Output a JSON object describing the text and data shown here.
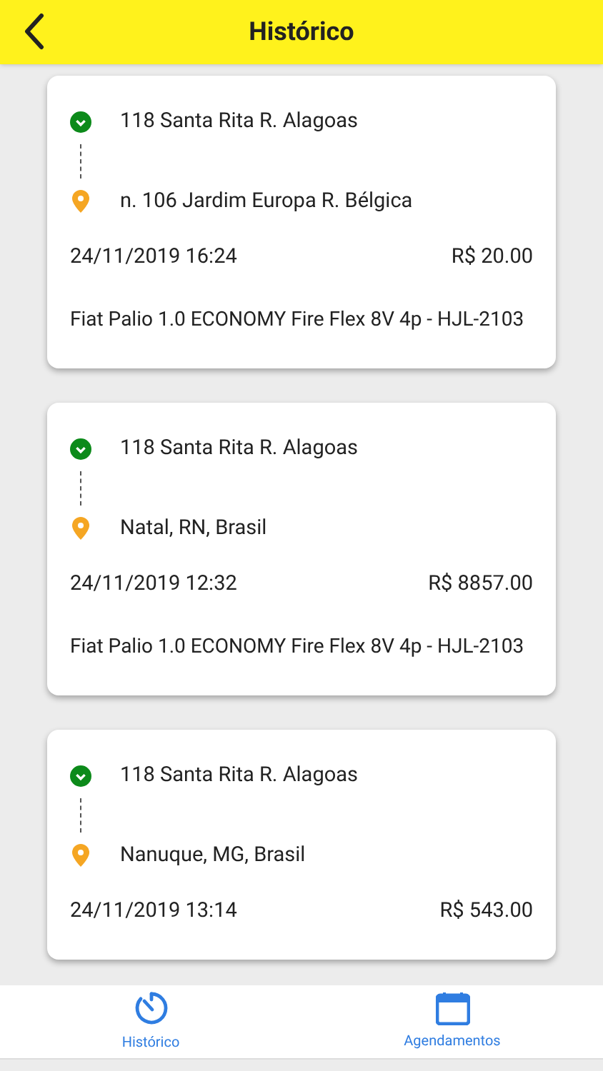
{
  "header": {
    "title": "Histórico"
  },
  "trips": [
    {
      "origin": "118 Santa Rita R. Alagoas",
      "destination": "n. 106 Jardim Europa R. Bélgica",
      "datetime": "24/11/2019 16:24",
      "price": "R$ 20.00",
      "vehicle": "Fiat Palio 1.0 ECONOMY Fire Flex 8V 4p - HJL-2103"
    },
    {
      "origin": "118 Santa Rita R. Alagoas",
      "destination": "Natal, RN, Brasil",
      "datetime": "24/11/2019 12:32",
      "price": "R$ 8857.00",
      "vehicle": "Fiat Palio 1.0 ECONOMY Fire Flex 8V 4p - HJL-2103"
    },
    {
      "origin": "118 Santa Rita R. Alagoas",
      "destination": "Nanuque, MG, Brasil",
      "datetime": "24/11/2019 13:14",
      "price": "R$ 543.00"
    }
  ],
  "bottom_nav": [
    {
      "label": "Histórico",
      "kind": "timer"
    },
    {
      "label": "Agendamentos",
      "kind": "calendar"
    }
  ]
}
